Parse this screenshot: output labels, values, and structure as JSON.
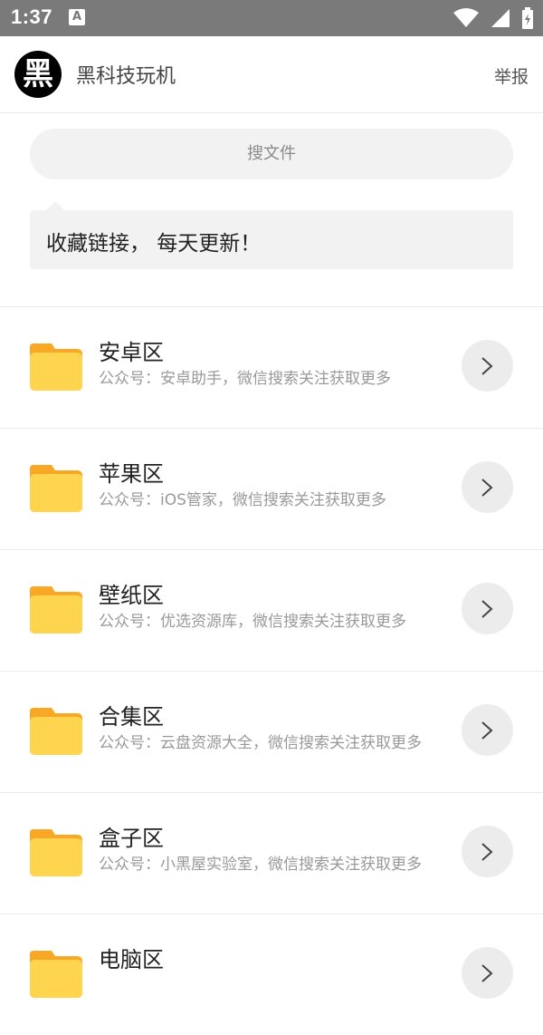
{
  "status_bar": {
    "time": "1:37",
    "notification_icon": "A"
  },
  "app_bar": {
    "avatar_glyph": "黑",
    "title": "黑科技玩机",
    "report_label": "举报"
  },
  "search": {
    "placeholder": "搜文件"
  },
  "notice": {
    "text": "收藏链接， 每天更新！"
  },
  "colors": {
    "folder_yellow": "#FFD54F",
    "folder_tab": "#F9A825",
    "status_bar": "#7a7a7a"
  },
  "folders": [
    {
      "name": "安卓区",
      "desc": "公众号：安卓助手，微信搜索关注获取更多"
    },
    {
      "name": "苹果区",
      "desc": "公众号：iOS管家，微信搜索关注获取更多"
    },
    {
      "name": "壁纸区",
      "desc": "公众号：优选资源库，微信搜索关注获取更多"
    },
    {
      "name": "合集区",
      "desc": "公众号：云盘资源大全，微信搜索关注获取更多"
    },
    {
      "name": "盒子区",
      "desc": "公众号：小黑屋实验室，微信搜索关注获取更多"
    },
    {
      "name": "电脑区",
      "desc": ""
    }
  ]
}
